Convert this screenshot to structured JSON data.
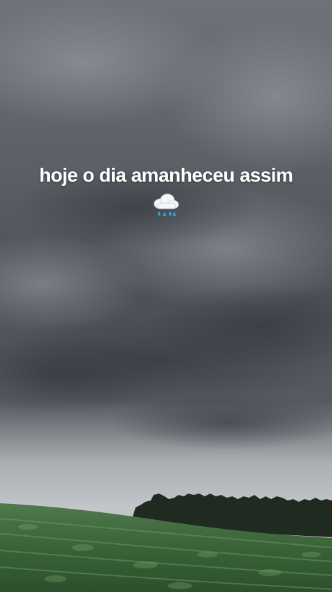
{
  "story": {
    "caption": "hoje o dia amanheceu assim",
    "emoji": "cloud-with-rain-emoji"
  },
  "colors": {
    "sky_top": "#6f747a",
    "sky_mid": "#4f555b",
    "sky_low": "#b8bcc0",
    "tree_line": "#1e2a20",
    "field": "#3f6b40",
    "caption_text": "#ffffff"
  }
}
